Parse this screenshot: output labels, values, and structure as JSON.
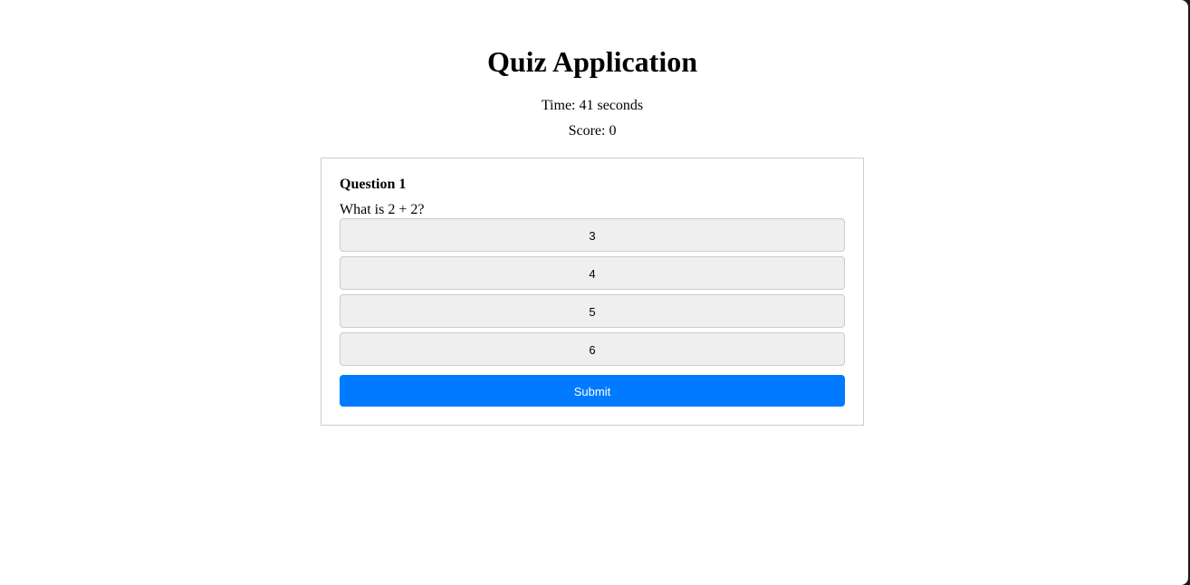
{
  "app": {
    "title": "Quiz Application"
  },
  "stats": {
    "time_text": "Time: 41 seconds",
    "score_text": "Score: 0"
  },
  "question": {
    "title": "Question 1",
    "text": "What is 2 + 2?",
    "options": [
      "3",
      "4",
      "5",
      "6"
    ]
  },
  "actions": {
    "submit_label": "Submit"
  },
  "colors": {
    "accent": "#007bff",
    "option_bg": "#efefef",
    "border": "#cccccc"
  }
}
